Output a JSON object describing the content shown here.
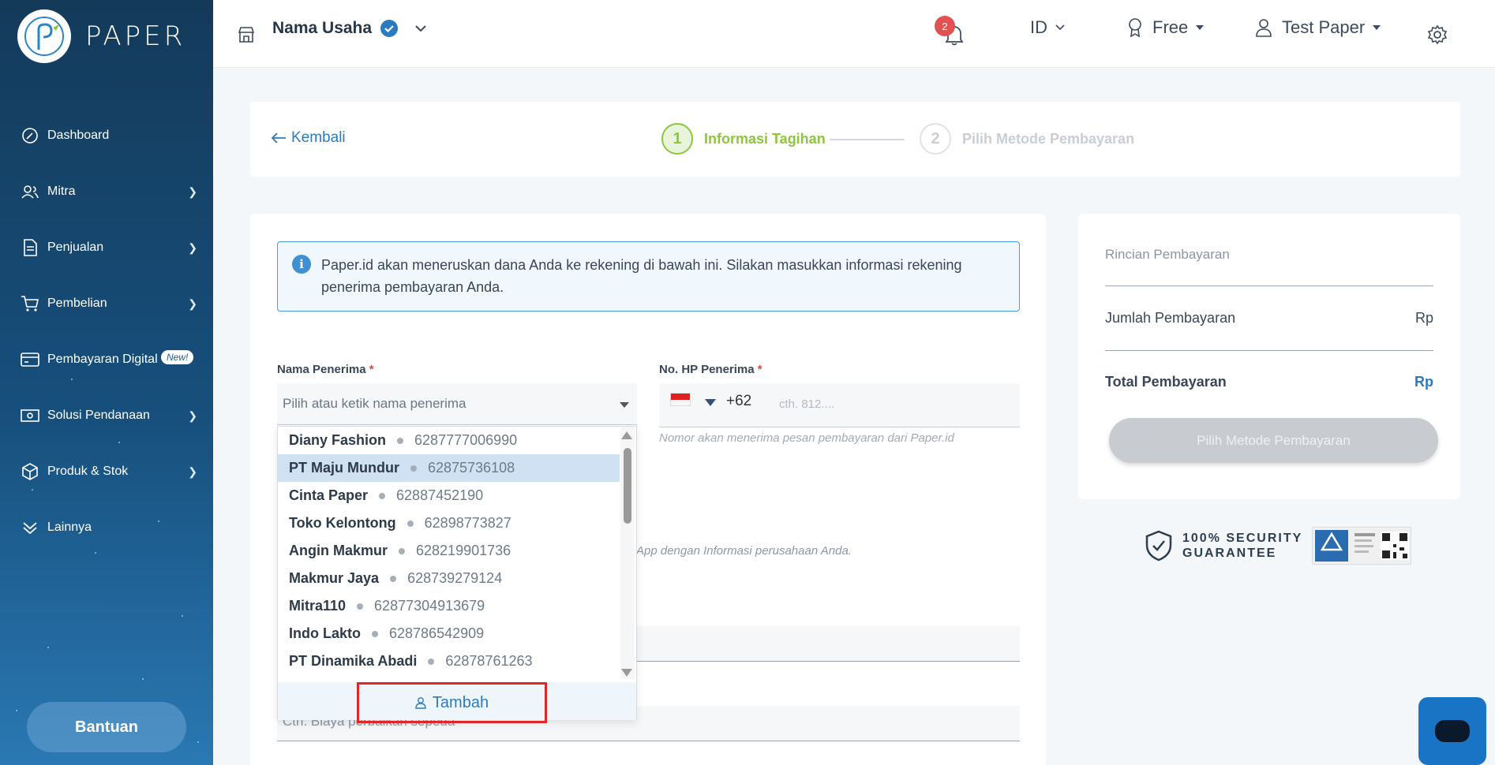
{
  "brand": {
    "name": "PAPER"
  },
  "sidebar": {
    "items": [
      {
        "label": "Dashboard",
        "icon": "dashboard-icon",
        "has_chevron": false
      },
      {
        "label": "Mitra",
        "icon": "users-icon",
        "has_chevron": true
      },
      {
        "label": "Penjualan",
        "icon": "document-icon",
        "has_chevron": true
      },
      {
        "label": "Pembelian",
        "icon": "cart-icon",
        "has_chevron": true
      },
      {
        "label": "Pembayaran Digital",
        "icon": "card-icon",
        "has_chevron": false,
        "badge": "New!"
      },
      {
        "label": "Solusi Pendanaan",
        "icon": "money-icon",
        "has_chevron": true
      },
      {
        "label": "Produk & Stok",
        "icon": "box-icon",
        "has_chevron": true
      },
      {
        "label": "Lainnya",
        "icon": "more-icon",
        "has_chevron": false
      }
    ],
    "help_button": "Bantuan"
  },
  "topbar": {
    "business_name": "Nama Usaha",
    "notification_count": "2",
    "language": "ID",
    "plan": "Free",
    "user": "Test Paper"
  },
  "stepper": {
    "back": "Kembali",
    "steps": [
      {
        "num": "1",
        "label": "Informasi Tagihan",
        "active": true
      },
      {
        "num": "2",
        "label": "Pilih Metode Pembayaran",
        "active": false
      }
    ]
  },
  "form": {
    "info": "Paper.id akan meneruskan dana Anda ke rekening di bawah ini. Silakan masukkan informasi rekening penerima pembayaran Anda.",
    "recipient_label": "Nama Penerima",
    "recipient_placeholder": "Pilih atau ketik nama penerima",
    "phone_label": "No. HP Penerima",
    "phone_code": "+62",
    "phone_placeholder": "cth. 812....",
    "phone_hint": "Nomor akan menerima pesan pembayaran dari Paper.id",
    "hidden_hint": "App dengan Informasi perusahaan Anda.",
    "description_placeholder": "Cth. Biaya perbaikan sepeda",
    "required_mark": "*"
  },
  "dropdown": {
    "options": [
      {
        "name": "Diany Fashion",
        "phone": "6287777006990"
      },
      {
        "name": "PT Maju Mundur",
        "phone": "62875736108"
      },
      {
        "name": "Cinta Paper",
        "phone": "62887452190"
      },
      {
        "name": "Toko Kelontong",
        "phone": "62898773827"
      },
      {
        "name": "Angin Makmur",
        "phone": "628219901736"
      },
      {
        "name": "Makmur Jaya",
        "phone": "628739279124"
      },
      {
        "name": "Mitra110",
        "phone": "62877304913679"
      },
      {
        "name": "Indo Lakto",
        "phone": "628786542909"
      },
      {
        "name": "PT Dinamika Abadi",
        "phone": "62878761263"
      }
    ],
    "highlighted_index": 1,
    "add_button": "Tambah"
  },
  "summary": {
    "title": "Rincian Pembayaran",
    "amount_label": "Jumlah Pembayaran",
    "amount_value": "Rp",
    "total_label": "Total Pembayaran",
    "total_value": "Rp",
    "pay_button": "Pilih Metode Pembayaran"
  },
  "security": {
    "line1": "100% SECURITY",
    "line2": "GUARANTEE"
  },
  "colors": {
    "accent": "#2c7bbf",
    "step_active": "#8cc63f",
    "step_inactive": "#c9ced4",
    "highlight": "#e02626"
  }
}
